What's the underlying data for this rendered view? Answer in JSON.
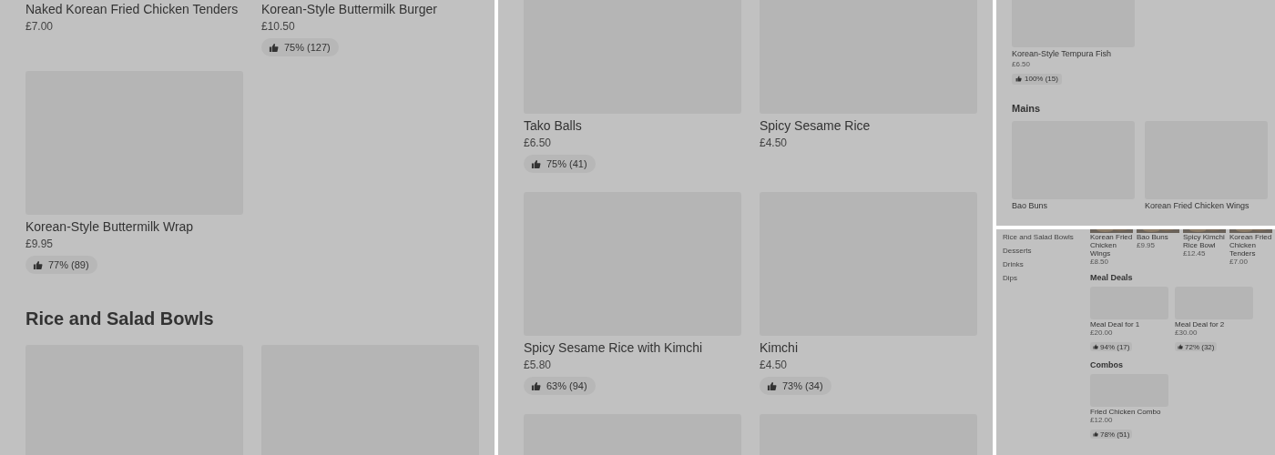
{
  "panels": [
    {
      "sections": [
        {
          "kind": "grid",
          "items": [
            {
              "kind": "text",
              "name": "Naked Korean Fried Chicken Tenders",
              "price": "£7.00"
            },
            {
              "kind": "text",
              "name": "Korean-Style Buttermilk Burger",
              "price": "£10.50",
              "rating": "75% (127)"
            },
            {
              "kind": "placeholder",
              "name": "Korean-Style Buttermilk Wrap",
              "price": "£9.95",
              "rating": "77% (89)"
            }
          ]
        },
        {
          "kind": "grid",
          "heading": "Rice and Salad Bowls",
          "items": [
            {
              "kind": "placeholder"
            },
            {
              "kind": "placeholder"
            }
          ]
        }
      ]
    },
    {
      "sections": [
        {
          "kind": "grid",
          "items": [
            {
              "kind": "placeholder",
              "name": "Tako Balls",
              "price": "£6.50",
              "rating": "75% (41)"
            },
            {
              "kind": "placeholder",
              "name": "Spicy Sesame Rice",
              "price": "£4.50"
            },
            {
              "kind": "placeholder",
              "name": "Spicy Sesame Rice with Kimchi",
              "price": "£5.80",
              "rating": "63% (94)"
            },
            {
              "kind": "placeholder",
              "name": "Kimchi",
              "price": "£4.50",
              "rating": "73% (34)"
            },
            {
              "kind": "placeholder"
            },
            {
              "kind": "placeholder"
            }
          ]
        }
      ]
    },
    {
      "sections": [
        {
          "kind": "grid",
          "items": [
            {
              "kind": "placeholder",
              "name": "Korean-Style Tempura Fish",
              "price": "£6.50",
              "rating": "100% (15)"
            }
          ]
        },
        {
          "kind": "grid",
          "heading": "Mains",
          "items": [
            {
              "kind": "placeholder",
              "name": "Bao Buns"
            },
            {
              "kind": "placeholder",
              "name": "Korean Fried Chicken Wings"
            }
          ]
        }
      ]
    },
    {
      "sidebar": [
        "Rice and Salad Bowls",
        "Desserts",
        "Drinks",
        "Dips"
      ],
      "sections": [
        {
          "kind": "strip",
          "items": [
            {
              "name": "Korean Fried Chicken Wings",
              "price": "£8.50"
            },
            {
              "name": "Bao Buns",
              "price": "£9.95"
            },
            {
              "name": "Spicy Kimchi Rice Bowl",
              "price": "£12.45"
            },
            {
              "name": "Korean Fried Chicken Tenders",
              "price": "£7.00"
            }
          ]
        },
        {
          "kind": "grid",
          "heading": "Meal Deals",
          "items": [
            {
              "kind": "placeholder",
              "name": "Meal Deal for 1",
              "price": "£20.00",
              "rating": "94% (17)"
            },
            {
              "kind": "placeholder",
              "name": "Meal Deal for 2",
              "price": "£30.00",
              "rating": "72% (32)"
            }
          ]
        },
        {
          "kind": "grid",
          "heading": "Combos",
          "items": [
            {
              "kind": "placeholder",
              "name": "Fried Chicken Combo",
              "price": "£12.00",
              "rating": "78% (51)"
            }
          ]
        }
      ]
    }
  ]
}
